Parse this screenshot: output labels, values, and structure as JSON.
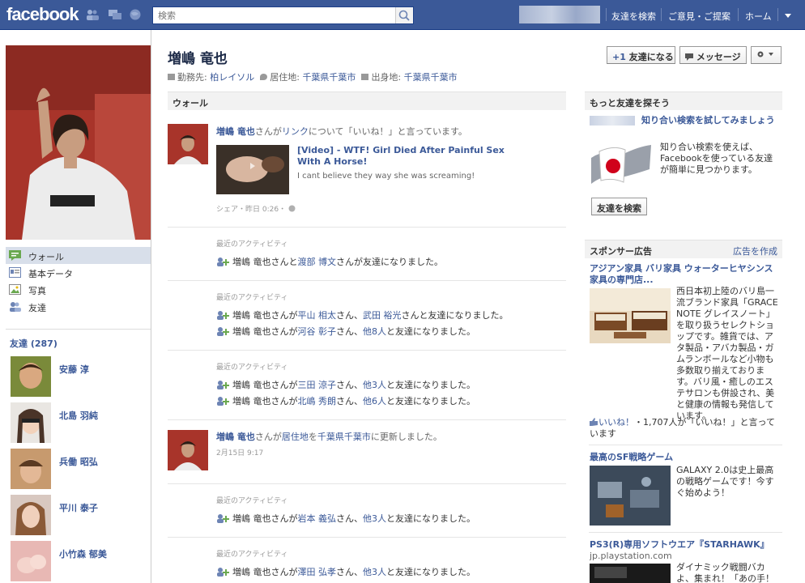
{
  "topbar": {
    "logo": "facebook",
    "search_placeholder": "検索",
    "nav": [
      "友達を検索",
      "ご意見・ご提案",
      "ホーム"
    ]
  },
  "profile": {
    "name": "増嶋 竜也",
    "info": {
      "work_label": "勤務先:",
      "work": "柏レイソル",
      "current_city_label": "居住地:",
      "current_city": "千葉県千葉市",
      "hometown_label": "出身地:",
      "hometown": "千葉県千葉市"
    },
    "buttons": {
      "add_friend": "友達になる",
      "message": "メッセージ"
    }
  },
  "left_nav": [
    "ウォール",
    "基本データ",
    "写真",
    "友達"
  ],
  "friends": {
    "header": "友達 (287)",
    "list": [
      "安藤 淳",
      "北島 羽純",
      "兵働 昭弘",
      "平川 泰子",
      "小竹森 郁美"
    ]
  },
  "wall": {
    "header": "ウォール",
    "story1": {
      "actor": "増嶋 竜也",
      "text_a": "さんが",
      "link_word": "リンク",
      "text_b": "について「いいね！」と言っています。",
      "link_title": "[Video] - WTF! Girl Died After Painful Sex With A Horse!",
      "link_desc": "I cant believe they way she was screaming!",
      "meta": "シェア・昨日 0:26・"
    },
    "activity_header": "最近のアクティビティ",
    "act1": {
      "actor": "増嶋 竜也",
      "pre": "さんと",
      "f1": "渡部 博文",
      "post": "さんが友達になりました。"
    },
    "act2a": {
      "actor": "増嶋 竜也",
      "pre": "さんが",
      "f1": "平山 相太",
      "mid": "さん、",
      "f2": "武田 裕光",
      "post": "さんと友達になりました。"
    },
    "act2b": {
      "actor": "増嶋 竜也",
      "pre": "さんが",
      "f1": "河谷 彰子",
      "mid": "さん、",
      "f2": "他8人",
      "post": "と友達になりました。"
    },
    "act3a": {
      "actor": "増嶋 竜也",
      "pre": "さんが",
      "f1": "三田 涼子",
      "mid": "さん、",
      "f2": "他3人",
      "post": "と友達になりました。"
    },
    "act3b": {
      "actor": "増嶋 竜也",
      "pre": "さんが",
      "f1": "北嶋 秀朗",
      "mid": "さん、",
      "f2": "他6人",
      "post": "と友達になりました。"
    },
    "story2": {
      "actor": "増嶋 竜也",
      "text_a": "さんが",
      "link_word": "居住地",
      "text_b": "を",
      "place": "千葉県千葉市",
      "text_c": "に更新しました。",
      "meta": "2月15日 9:17"
    },
    "act4": {
      "actor": "増嶋 竜也",
      "pre": "さんが",
      "f1": "岩本 義弘",
      "mid": "さん、",
      "f2": "他3人",
      "post": "と友達になりました。"
    },
    "act5": {
      "actor": "増嶋 竜也",
      "pre": "さんが",
      "f1": "澤田 弘孝",
      "mid": "さん、",
      "f2": "他3人",
      "post": "と友達になりました。"
    }
  },
  "right": {
    "find_friends": {
      "header": "もっと友達を探そう",
      "link": "知り合い検索を試してみましょう",
      "desc": "知り合い検索を使えば、Facebookを使っている友達が簡単に見つかります。",
      "button": "友達を検索"
    },
    "ads": {
      "header": "スポンサー広告",
      "create_link": "広告を作成",
      "ad1": {
        "title": "アジアン家具 バリ家具 ウォーターヒヤシンス家具の専門店...",
        "body": "西日本初上陸のバリ島一流ブランド家具「GRACE NOTE グレイスノート」を取り扱うセレクトショップです。雑貨では、アタ製品・アバカ製品・ガムランボールなど小物も多数取り揃えております。バリ風・癒しのエステサロンも併設され、美と健康の情報も発信しています。",
        "like_label": "いいね！",
        "likes_text": "・1,707人が「いいね！」と言っています"
      },
      "ad2": {
        "title": "最高のSF戦略ゲーム",
        "body": "GALAXY 2.0は史上最高の戦略ゲームです！今すぐ始めよう！"
      },
      "ad3": {
        "title": "PS3(R)専用ソフトウエア『STARHAWK』",
        "domain": "jp.playstation.com",
        "body": "ダイナミック戦闘バカよ、集まれ！「あの手！"
      }
    }
  }
}
